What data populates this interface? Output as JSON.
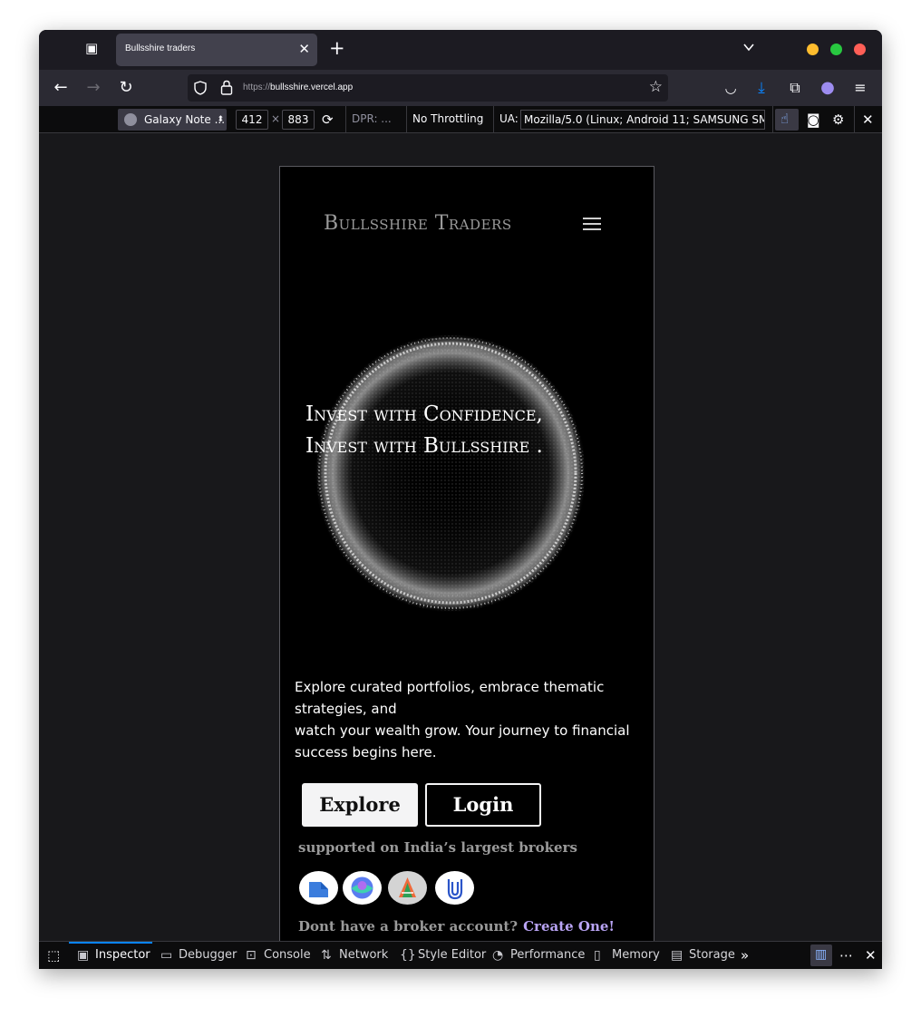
{
  "browser": {
    "tab_title": "Bullsshire traders",
    "url_scheme": "https://",
    "url_host": "bullsshire.vercel.app"
  },
  "rdm": {
    "device": "Galaxy Note ...",
    "width": "412",
    "times": "×",
    "height": "883",
    "dpr": "DPR: ...",
    "throttling": "No Throttling",
    "ua_label": "UA:",
    "ua_value": "Mozilla/5.0 (Linux; Android 11; SAMSUNG SM-G"
  },
  "site": {
    "brand": "Bullsshire Traders",
    "hero_line1": "Invest with Confidence,",
    "hero_line2": "Invest with Bullsshire .",
    "desc_line1": "Explore curated portfolios, embrace thematic strategies, and",
    "desc_line2": "watch your wealth grow. Your journey to financial success begins here.",
    "explore_label": "Explore",
    "login_label": "Login",
    "brokers_label": "supported on India’s largest brokers",
    "brokers": [
      "broker-1",
      "broker-2",
      "broker-3",
      "broker-4"
    ],
    "cta_text": "Dont have a broker account?",
    "cta_link": "Create One!"
  },
  "devtools": {
    "tabs": [
      "Inspector",
      "Debugger",
      "Console",
      "Network",
      "Style Editor",
      "Performance",
      "Memory",
      "Storage"
    ],
    "active_tab": "Inspector"
  },
  "colors": {
    "accent": "#0a84ff",
    "link": "#b9a4f5",
    "minimize": "#ffbd2e",
    "maximize": "#28c840",
    "close": "#ff5f57"
  }
}
